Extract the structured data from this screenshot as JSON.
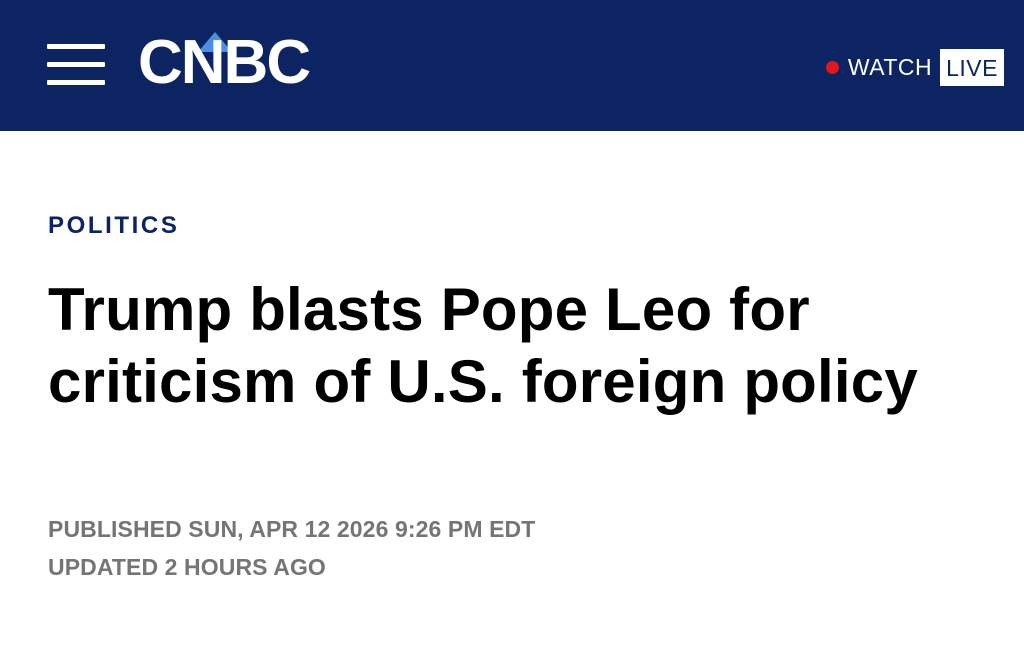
{
  "header": {
    "logo_text": "CNBC",
    "watch_label": "WATCH",
    "live_label": "LIVE",
    "menu_icon": "hamburger-menu-icon",
    "live_dot_icon": "live-dot-icon",
    "colors": {
      "bar_background": "#0c2461",
      "live_dot": "#e3161b",
      "logo_peacock": "#4a90e2"
    }
  },
  "article": {
    "category": "POLITICS",
    "headline": "Trump blasts Pope Leo for criticism of U.S. foreign policy",
    "published": "PUBLISHED SUN, APR 12 2026 9:26 PM EDT",
    "updated": "UPDATED 2 HOURS AGO"
  }
}
